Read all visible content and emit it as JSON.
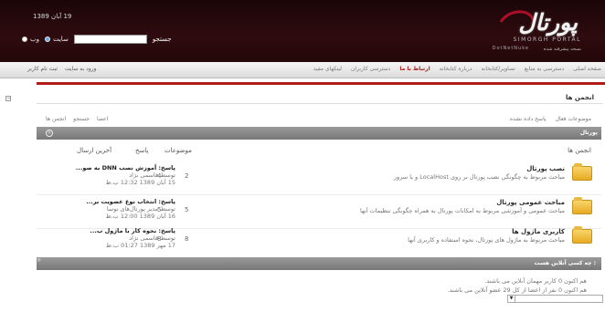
{
  "header": {
    "date": "19 آبان 1389",
    "logo": {
      "main": "پورتال",
      "subtitle": "SIMORGH PORTAL",
      "dnn": "DotNetNuke",
      "subtitle_fa": "نسخه پیشرفته شده"
    },
    "search": {
      "label": "جستجو",
      "value": "",
      "option_web": "وب",
      "option_site": "سایت",
      "selected": "site"
    }
  },
  "navbar": {
    "menu": [
      "صفحه اصلی",
      "دسترسی به منابع",
      "تصاویر/کتابخانه",
      "درباره کتابخانه",
      "ارتباط با ما",
      "دسترسی کاربران",
      "لینکهای مفید"
    ],
    "active_index": 4,
    "user_links": [
      "ثبت نام کاربر",
      "ورود به سایت"
    ]
  },
  "forum": {
    "title": "انجمن ها",
    "links_left": [
      "انجمن ها",
      "جستجو",
      "اعضا"
    ],
    "links_right": [
      "پاسخ داده نشده",
      "موضوعات فعال"
    ],
    "category": "پورتال",
    "columns": {
      "forums": "انجمن ها",
      "topics": "موضوعات",
      "replies": "پاسخ",
      "last_post": "آخرین ارسال"
    },
    "rows": [
      {
        "name": "نصب پورتال",
        "desc": "مباحث مربوط به چگونگی نصب پورتال بر روی LocalHost و یا سرور",
        "topics": "2",
        "replies": "4",
        "last_title": "پاسخ: آموزش نصب DNN به صو...",
        "last_by": "توسط قاسمی نژاد",
        "last_date": "15 آبان 1389 12:32 ب.ظ"
      },
      {
        "name": "مباحث عمومی پورتال",
        "desc": "مباحث عمومی و آموزشی مربوط به امکانات پورتال به همراه چگونگی تنظیمات آنها",
        "topics": "5",
        "replies": "5",
        "last_title": "پاسخ: انتخاب نوع عضویت بر...",
        "last_by": "توسط مدیر پورتال‌های نوسا",
        "last_date": "16 آبان 1389 12:00 ب.ظ"
      },
      {
        "name": "کاربری ماژول ها",
        "desc": "مباحث مربوط به ماژول های پورتال، نحوه استفاده و کاربری آنها",
        "topics": "8",
        "replies": "8",
        "last_title": "پاسخ: نحوه کار با ماژول ب...",
        "last_by": "توسط قاسمی نژاد",
        "last_date": "17 مهر 1389 01:27 ب.ظ"
      }
    ]
  },
  "online": {
    "title": "چه کسی آنلاین هست :",
    "line1": "هم اکنون 0 کاربر مهمان آنلاین می باشند.",
    "line2": "هم اکنون 0 نفر از اعضا از کل 29 عضو آنلاین می باشند."
  },
  "colors": {
    "header_bg": "#2a0a0c",
    "accent": "#b21b1b",
    "folder": "#f0c040"
  }
}
